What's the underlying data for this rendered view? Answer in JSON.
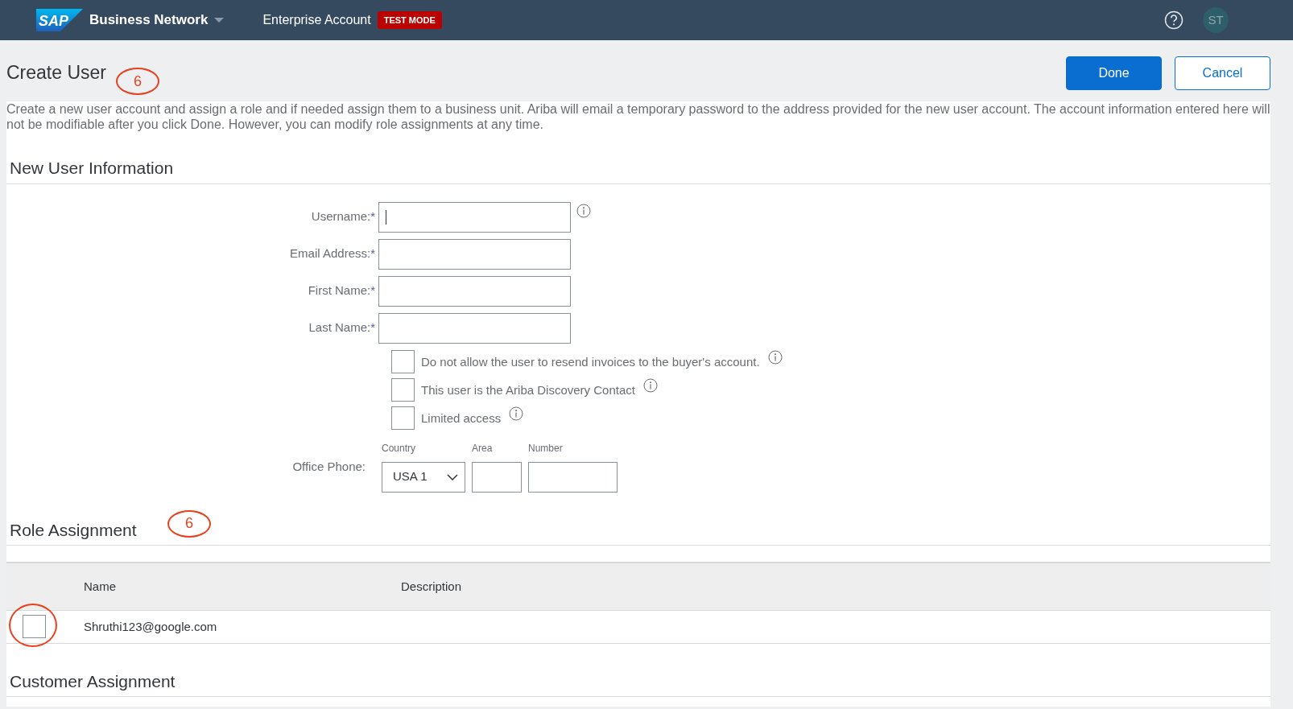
{
  "header": {
    "logo": "SAP",
    "product": "Business Network",
    "account": "Enterprise Account",
    "mode_badge": "TEST MODE",
    "avatar": "ST"
  },
  "page": {
    "title": "Create User",
    "annotation": "6",
    "buttons": [
      {
        "label": "Done",
        "kind": "primary"
      },
      {
        "label": "Cancel",
        "kind": "secondary"
      }
    ],
    "description": "Create a new user account and assign a role and if needed assign them to a business unit. Ariba will email a temporary password to the address provided for the new user account. The account information entered here will not be modifiable after you click Done. However, you can modify role assignments at any time."
  },
  "new_user": {
    "heading": "New User Information",
    "fields": [
      {
        "label": "Username:",
        "required_mark": "*",
        "info": true,
        "focused": true
      },
      {
        "label": "Email Address:",
        "required_mark": "*",
        "info": false,
        "focused": false
      },
      {
        "label": "First Name:",
        "required_mark": "*",
        "info": false,
        "focused": false
      },
      {
        "label": "Last Name:",
        "required_mark": "*",
        "info": false,
        "focused": false
      }
    ],
    "checkboxes": [
      {
        "label": "Do not allow the user to resend invoices to the buyer's account.",
        "checked": false,
        "info": true
      },
      {
        "label": "This user is the Ariba Discovery Contact",
        "checked": false,
        "info": true
      },
      {
        "label": "Limited access",
        "checked": false,
        "info": true
      }
    ],
    "office_phone": {
      "label": "Office Phone:",
      "country_label": "Country",
      "country": "USA 1",
      "area_label": "Area",
      "number_label": "Number"
    }
  },
  "role_assignment": {
    "heading": "Role Assignment",
    "annotation": "6",
    "columns": [
      "Name",
      "Description"
    ],
    "rows": [
      {
        "name": "Shruthi123@google.com",
        "selected": false,
        "annotated": true
      }
    ]
  },
  "customer_assignment": {
    "heading": "Customer Assignment"
  }
}
